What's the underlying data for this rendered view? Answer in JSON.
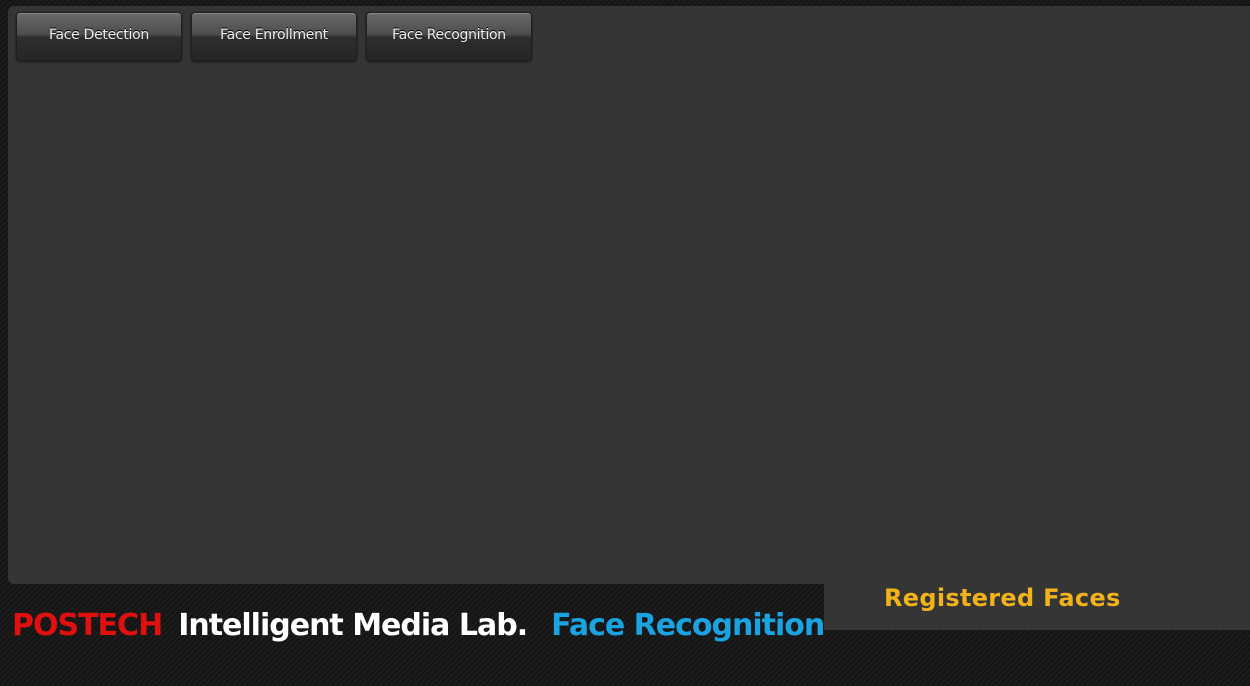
{
  "toolbar": {
    "buttons": [
      {
        "label": "Face Detection"
      },
      {
        "label": "Face Enrollment"
      },
      {
        "label": "Face Recognition"
      }
    ]
  },
  "registered": {
    "label": "Registered Faces"
  },
  "footer": {
    "org": "POSTECH",
    "lab": "Intelligent Media Lab.",
    "app": "Face Recognition"
  },
  "colors": {
    "panel_background": "#353535",
    "org_red": "#e01010",
    "lab_white": "#ffffff",
    "app_blue": "#1aa3e0",
    "registered_orange": "#f2b21a"
  }
}
